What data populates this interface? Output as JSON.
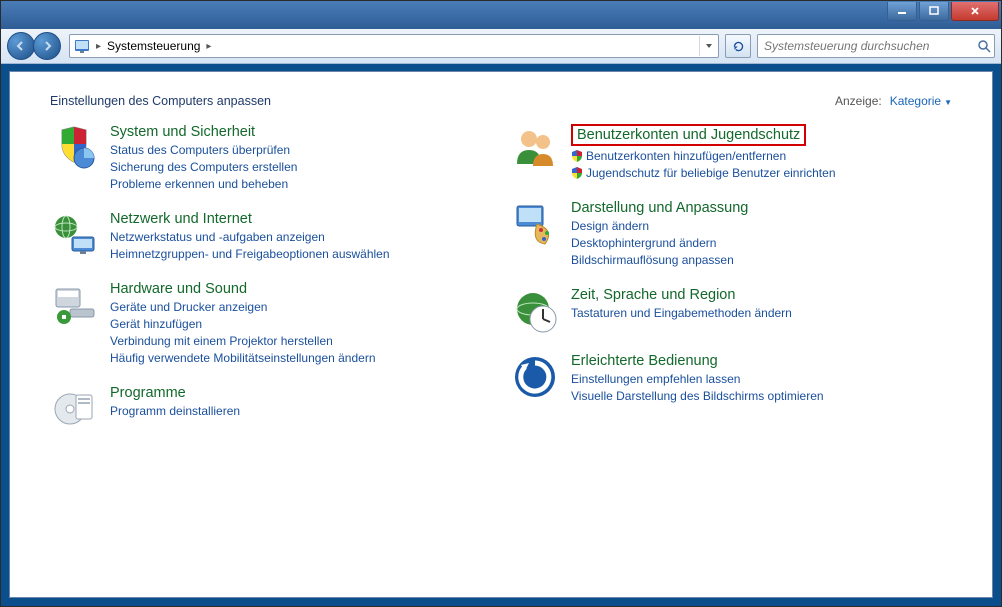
{
  "titlebar": {},
  "nav": {
    "breadcrumb_root": "Systemsteuerung",
    "search_placeholder": "Systemsteuerung durchsuchen"
  },
  "header": {
    "title": "Einstellungen des Computers anpassen",
    "view_label": "Anzeige:",
    "view_value": "Kategorie"
  },
  "left": [
    {
      "icon": "shield-chart",
      "title": "System und Sicherheit",
      "tasks": [
        {
          "label": "Status des Computers überprüfen"
        },
        {
          "label": "Sicherung des Computers erstellen"
        },
        {
          "label": "Probleme erkennen und beheben"
        }
      ]
    },
    {
      "icon": "network",
      "title": "Netzwerk und Internet",
      "tasks": [
        {
          "label": "Netzwerkstatus und -aufgaben anzeigen"
        },
        {
          "label": "Heimnetzgruppen- und Freigabeoptionen auswählen"
        }
      ]
    },
    {
      "icon": "hardware",
      "title": "Hardware und Sound",
      "tasks": [
        {
          "label": "Geräte und Drucker anzeigen"
        },
        {
          "label": "Gerät hinzufügen"
        },
        {
          "label": "Verbindung mit einem Projektor herstellen"
        },
        {
          "label": "Häufig verwendete Mobilitätseinstellungen ändern"
        }
      ]
    },
    {
      "icon": "programs",
      "title": "Programme",
      "tasks": [
        {
          "label": "Programm deinstallieren"
        }
      ]
    }
  ],
  "right": [
    {
      "icon": "users",
      "title": "Benutzerkonten und Jugendschutz",
      "highlight": true,
      "tasks": [
        {
          "label": "Benutzerkonten hinzufügen/entfernen",
          "shield": true
        },
        {
          "label": "Jugendschutz für beliebige Benutzer einrichten",
          "shield": true
        }
      ]
    },
    {
      "icon": "appearance",
      "title": "Darstellung und Anpassung",
      "tasks": [
        {
          "label": "Design ändern"
        },
        {
          "label": "Desktophintergrund ändern"
        },
        {
          "label": "Bildschirmauflösung anpassen"
        }
      ]
    },
    {
      "icon": "clock",
      "title": "Zeit, Sprache und Region",
      "tasks": [
        {
          "label": "Tastaturen und Eingabemethoden ändern"
        }
      ]
    },
    {
      "icon": "ease",
      "title": "Erleichterte Bedienung",
      "tasks": [
        {
          "label": "Einstellungen empfehlen lassen"
        },
        {
          "label": "Visuelle Darstellung des Bildschirms optimieren"
        }
      ]
    }
  ]
}
